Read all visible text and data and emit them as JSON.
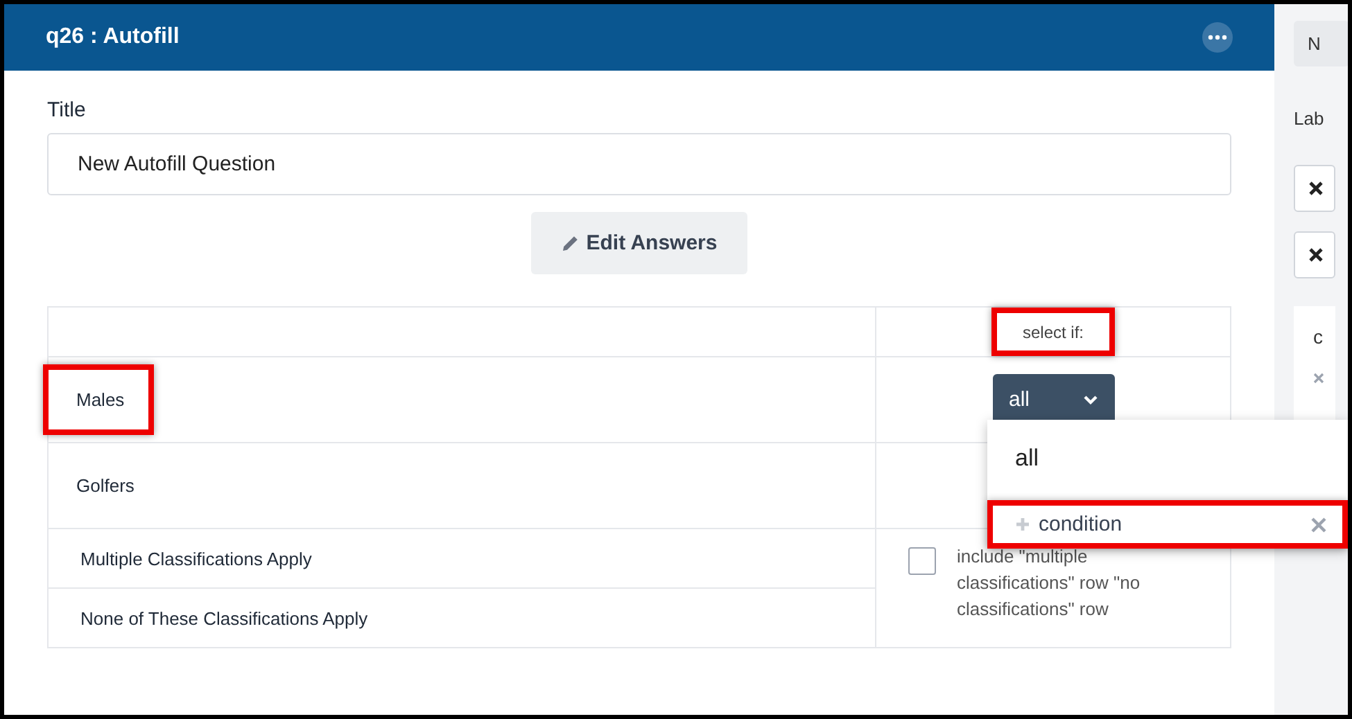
{
  "panel": {
    "title": "q26 : Autofill",
    "title_label": "Title",
    "title_value": "New Autofill Question",
    "edit_button": "Edit Answers"
  },
  "table": {
    "select_header": "select if:",
    "select_header_highlighted": true,
    "rows": [
      {
        "label": "Males",
        "highlighted": true
      },
      {
        "label": "Golfers",
        "highlighted": false
      }
    ],
    "special_rows": [
      "Multiple Classifications Apply",
      "None of These Classifications Apply"
    ],
    "include_checkbox": {
      "label": "include \"multiple classifications\" row \"no classifications\" row",
      "checked": false
    }
  },
  "select": {
    "value": "all",
    "expanded": true,
    "options": [
      {
        "kind": "item",
        "label": "all",
        "highlighted": false
      },
      {
        "kind": "condition",
        "label": "condition",
        "highlighted": true
      }
    ]
  },
  "side": {
    "top_button": "N",
    "label": "Lab",
    "card_text": "c"
  }
}
